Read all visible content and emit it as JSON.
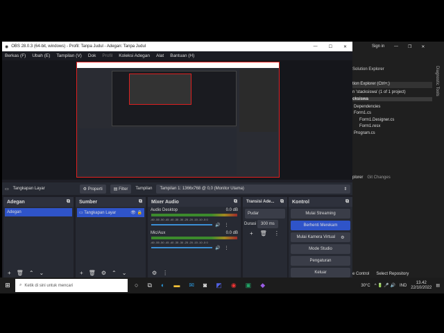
{
  "obs": {
    "title": "OBS 28.0.3 (64-bit, windows) - Profil: Tanpa Judul - Adegan: Tanpa Judul",
    "menu": [
      "Berkas (F)",
      "Ubah (E)",
      "Tampilan (V)",
      "Dok",
      "Profil",
      "Koleksi Adegan",
      "Alat",
      "Bantuan (H)"
    ],
    "source_bar": {
      "source": "Tangkapan Layar",
      "properties": "Properti",
      "filter": "Filter",
      "display_label": "Tampilan",
      "display_value": "Tampilan 1: 1366x768 @ 0,0 (Monitor Utama)"
    },
    "scenes": {
      "title": "Adegan",
      "items": [
        "Adegan"
      ]
    },
    "sources": {
      "title": "Sumber",
      "items": [
        "Tangkapan Layar"
      ]
    },
    "mixer": {
      "title": "Mixer Audio",
      "channels": [
        {
          "name": "Audio Desktop",
          "level": "0.0 dB"
        },
        {
          "name": "Mic/Aux",
          "level": "0.0 dB"
        }
      ],
      "scale": "-60 -55 -50 -45 -40 -35 -30 -25 -20 -15 -10 -5 0"
    },
    "transitions": {
      "title": "Transisi Ade...",
      "type": "Pudar",
      "duration_label": "Durasi",
      "duration": "300 ms"
    },
    "controls": {
      "title": "Kontrol",
      "buttons": [
        "Mulai Streaming",
        "Berhenti Merekam",
        "Mulai Kamera Virtual",
        "Mode Studio",
        "Pengaturan",
        "Keluar"
      ]
    }
  },
  "vs": {
    "sign_in": "Sign in",
    "panel": "Solution Explorer",
    "search": "tion Explorer (Ctrl+;)",
    "solution": "n 'stacksiswa' (1 of 1 project)",
    "project": "cksiswa",
    "tree": [
      "Dependencies",
      "Form1.cs",
      "Form1.Designer.cs",
      "Form1.resx",
      "Program.cs"
    ],
    "tabs": [
      "plorer",
      "Git Changes"
    ],
    "side": "Diagnostic Tools",
    "status": [
      "e Control",
      "Select Repository"
    ]
  },
  "taskbar": {
    "search_placeholder": "Ketik di sini untuk mencari",
    "temp": "30°C",
    "lang": "IND",
    "time": "13.42",
    "date": "22/10/2022"
  }
}
